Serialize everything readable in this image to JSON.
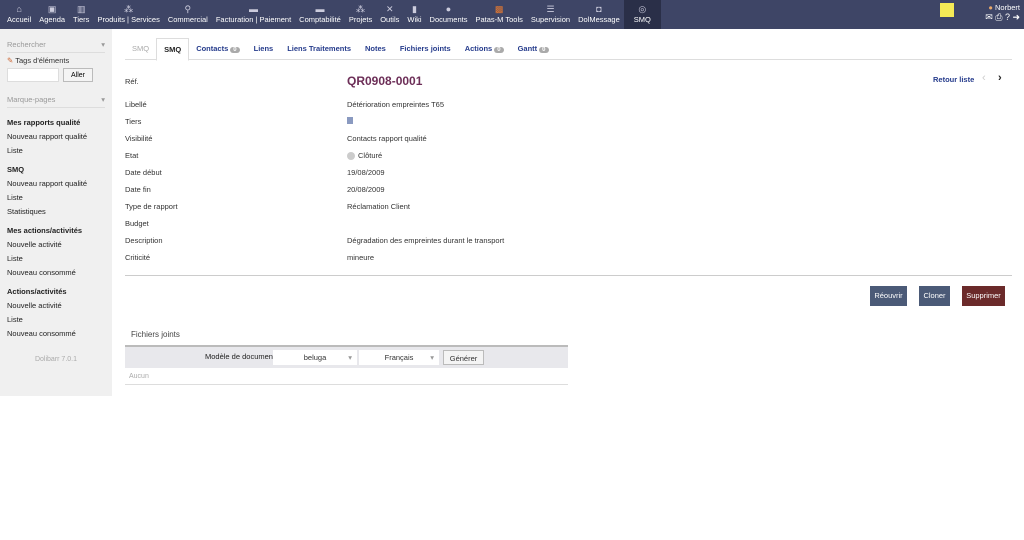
{
  "topmenu": [
    "Accueil",
    "Agenda",
    "Tiers",
    "Produits | Services",
    "Commercial",
    "Facturation | Paiement",
    "Comptabilité",
    "Projets",
    "Outils",
    "Wiki",
    "Documents",
    "Patas-M Tools",
    "Supervision",
    "DolMessage",
    "SMQ"
  ],
  "user": "Norbert",
  "sidebar": {
    "search": "Rechercher",
    "tags": "Tags d'éléments",
    "go": "Aller",
    "bookmarks": "Marque-pages",
    "sections": [
      {
        "title": "Mes rapports qualité",
        "items": [
          "Nouveau rapport qualité",
          "Liste"
        ]
      },
      {
        "title": "SMQ",
        "items": [
          "Nouveau rapport qualité",
          "Liste",
          "Statistiques"
        ]
      },
      {
        "title": "Mes actions/activités",
        "items": [
          "Nouvelle activité",
          "Liste",
          "Nouveau consommé"
        ]
      },
      {
        "title": "Actions/activités",
        "items": [
          "Nouvelle activité",
          "Liste",
          "Nouveau consommé"
        ]
      }
    ],
    "version": "Dolibarr 7.0.1"
  },
  "tabs": [
    {
      "label": "SMQ"
    },
    {
      "label": "SMQ"
    },
    {
      "label": "Contacts",
      "badge": "0"
    },
    {
      "label": "Liens"
    },
    {
      "label": "Liens Traitements"
    },
    {
      "label": "Notes"
    },
    {
      "label": "Fichiers joints"
    },
    {
      "label": "Actions",
      "badge": "0"
    },
    {
      "label": "Gantt",
      "badge": "0"
    }
  ],
  "card": {
    "ref_label": "Réf.",
    "ref": "QR0908-0001",
    "back": "Retour liste",
    "fields": [
      {
        "label": "Libellé",
        "value": "Détérioration empreintes T65"
      },
      {
        "label": "Tiers",
        "value": ""
      },
      {
        "label": "Visibilité",
        "value": "Contacts rapport qualité"
      },
      {
        "label": "Etat",
        "value": "Clôturé"
      },
      {
        "label": "Date début",
        "value": "19/08/2009"
      },
      {
        "label": "Date fin",
        "value": "20/08/2009"
      },
      {
        "label": "Type de rapport",
        "value": "Réclamation Client"
      },
      {
        "label": "Budget",
        "value": ""
      },
      {
        "label": "Description",
        "value": "Dégradation des empreintes durant le transport"
      },
      {
        "label": "Criticité",
        "value": "mineure"
      }
    ]
  },
  "actions": {
    "reopen": "Réouvrir",
    "clone": "Cloner",
    "delete": "Supprimer"
  },
  "files": {
    "title": "Fichiers joints",
    "model_label": "Modèle de document",
    "model": "beluga",
    "lang": "Français",
    "generate": "Générer",
    "none": "Aucun"
  }
}
